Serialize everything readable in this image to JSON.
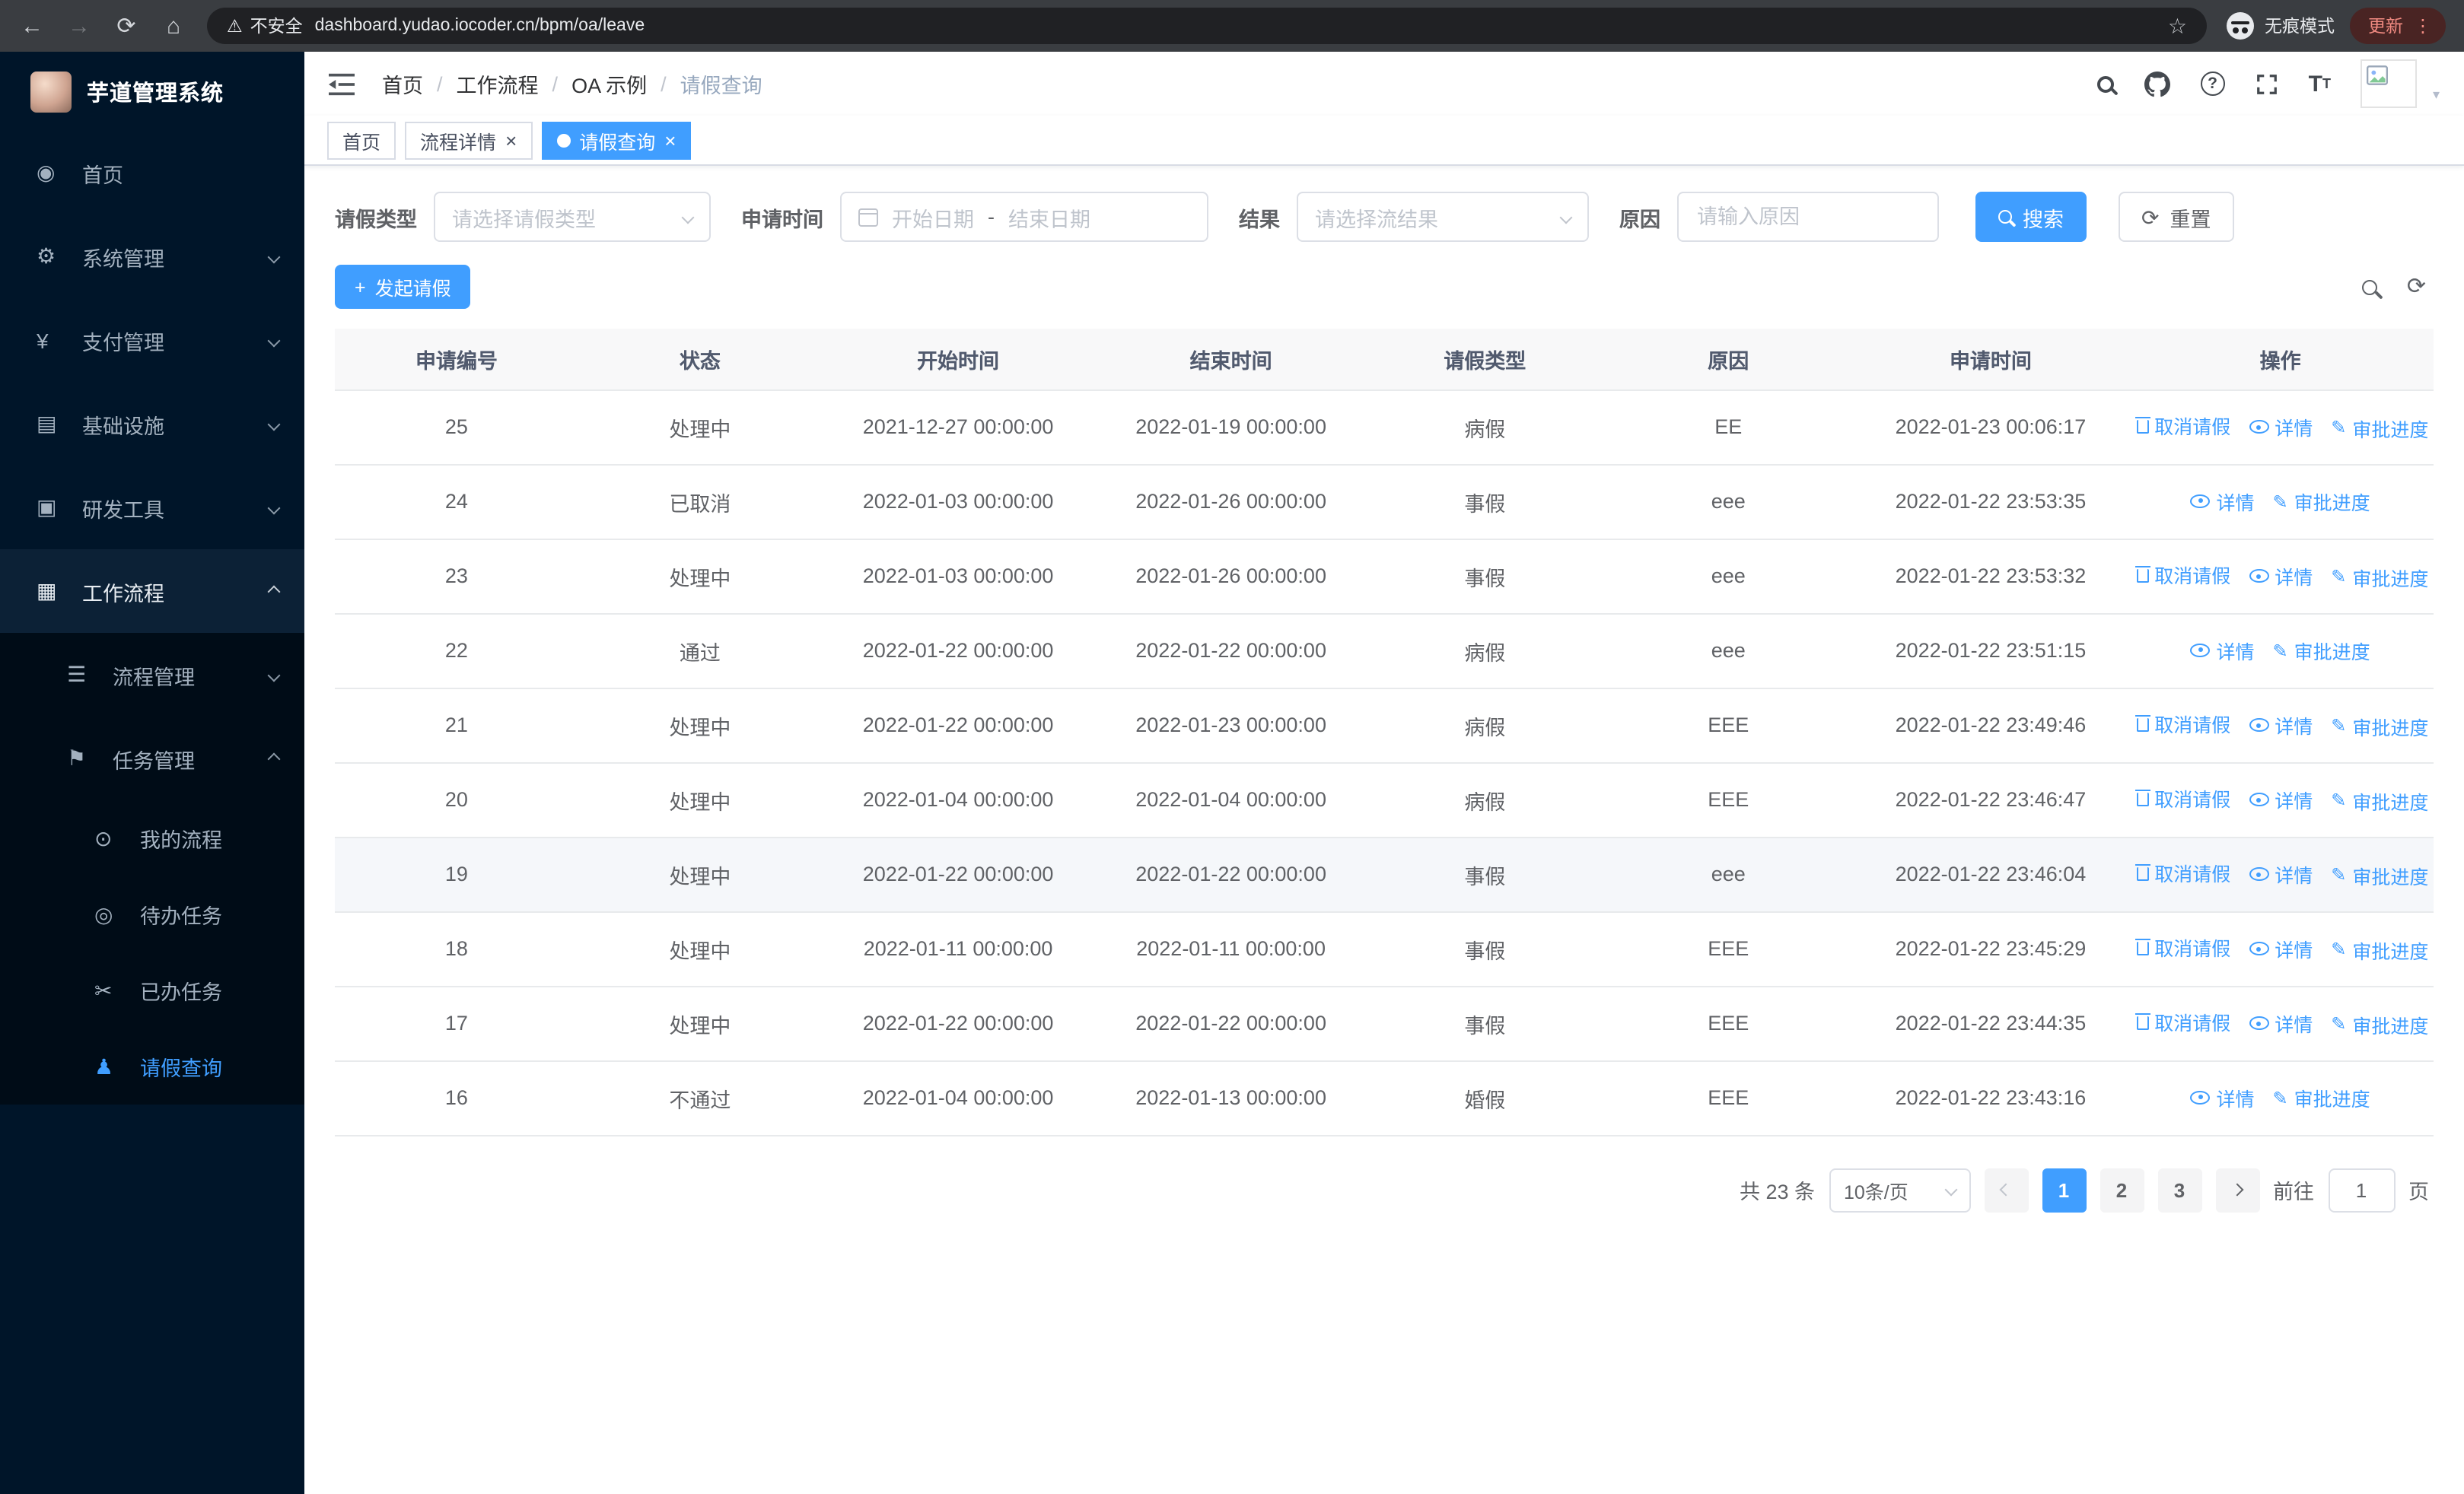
{
  "browser": {
    "security_label": "不安全",
    "url_domain": "dashboard.yudao.iocoder.cn",
    "url_path": "/bpm/oa/leave",
    "incognito_label": "无痕模式",
    "update_label": "更新"
  },
  "glyphs": {
    "back": "←",
    "forward": "→",
    "reload": "⟳",
    "home": "⌂",
    "warning": "⚠",
    "star": "☆",
    "menu_dots": "⋮",
    "close": "×",
    "caret": "▾",
    "refresh": "⟳",
    "plus": "+",
    "help": "?",
    "textsize_big": "T",
    "textsize_small": "T",
    "edit": "✎",
    "breadcrumb_sep": "/",
    "date_sep": "-"
  },
  "app": {
    "title": "芋道管理系统"
  },
  "sidebar": {
    "menu": [
      {
        "id": "home",
        "label": "首页",
        "icon": "dashboard-icon",
        "glyph": "◉",
        "level": 1,
        "chevron": ""
      },
      {
        "id": "system",
        "label": "系统管理",
        "icon": "gear-icon",
        "glyph": "⚙",
        "level": 1,
        "chevron": "down"
      },
      {
        "id": "payment",
        "label": "支付管理",
        "icon": "yen-icon",
        "glyph": "¥",
        "level": 1,
        "chevron": "down"
      },
      {
        "id": "infrastructure",
        "label": "基础设施",
        "icon": "monitor-icon",
        "glyph": "▤",
        "level": 1,
        "chevron": "down"
      },
      {
        "id": "devtools",
        "label": "研发工具",
        "icon": "toolbox-icon",
        "glyph": "▣",
        "level": 1,
        "chevron": "down"
      },
      {
        "id": "workflow",
        "label": "工作流程",
        "icon": "briefcase-icon",
        "glyph": "▦",
        "level": 1,
        "chevron": "up",
        "highlight": true
      },
      {
        "id": "process-mgmt",
        "label": "流程管理",
        "icon": "list-icon",
        "glyph": "☰",
        "level": 2,
        "chevron": "down",
        "dark": true
      },
      {
        "id": "task-mgmt",
        "label": "任务管理",
        "icon": "flag-icon",
        "glyph": "⚑",
        "level": 2,
        "chevron": "up",
        "dark": true
      },
      {
        "id": "my-process",
        "label": "我的流程",
        "icon": "chat-icon",
        "glyph": "⊙",
        "level": 3,
        "dark": true
      },
      {
        "id": "todo-tasks",
        "label": "待办任务",
        "icon": "eye-icon",
        "glyph": "◎",
        "level": 3,
        "dark": true
      },
      {
        "id": "done-tasks",
        "label": "已办任务",
        "icon": "scissors-icon",
        "glyph": "✂",
        "level": 3,
        "dark": true
      },
      {
        "id": "leave-query",
        "label": "请假查询",
        "icon": "person-icon",
        "glyph": "♟",
        "level": 3,
        "dark": true,
        "active": true
      }
    ]
  },
  "breadcrumb": {
    "items": [
      "首页",
      "工作流程",
      "OA 示例",
      "请假查询"
    ]
  },
  "tabs": [
    {
      "label": "首页",
      "closable": false,
      "active": false
    },
    {
      "label": "流程详情",
      "closable": true,
      "active": false
    },
    {
      "label": "请假查询",
      "closable": true,
      "active": true
    }
  ],
  "filters": {
    "leave_type_label": "请假类型",
    "leave_type_placeholder": "请选择请假类型",
    "apply_time_label": "申请时间",
    "start_placeholder": "开始日期",
    "end_placeholder": "结束日期",
    "result_label": "结果",
    "result_placeholder": "请选择流结果",
    "reason_label": "原因",
    "reason_placeholder": "请输入原因",
    "search_label": "搜索",
    "reset_label": "重置"
  },
  "toolbar": {
    "create_label": "发起请假"
  },
  "table": {
    "columns": [
      "申请编号",
      "状态",
      "开始时间",
      "结束时间",
      "请假类型",
      "原因",
      "申请时间",
      "操作"
    ],
    "rows": [
      {
        "id": "25",
        "status": "处理中",
        "start": "2021-12-27 00:00:00",
        "end": "2022-01-19 00:00:00",
        "type": "病假",
        "reason": "EE",
        "applied": "2022-01-23 00:06:17",
        "actions": [
          "cancel",
          "detail",
          "progress"
        ],
        "hover": false
      },
      {
        "id": "24",
        "status": "已取消",
        "start": "2022-01-03 00:00:00",
        "end": "2022-01-26 00:00:00",
        "type": "事假",
        "reason": "eee",
        "applied": "2022-01-22 23:53:35",
        "actions": [
          "detail",
          "progress"
        ],
        "hover": false
      },
      {
        "id": "23",
        "status": "处理中",
        "start": "2022-01-03 00:00:00",
        "end": "2022-01-26 00:00:00",
        "type": "事假",
        "reason": "eee",
        "applied": "2022-01-22 23:53:32",
        "actions": [
          "cancel",
          "detail",
          "progress"
        ],
        "hover": false
      },
      {
        "id": "22",
        "status": "通过",
        "start": "2022-01-22 00:00:00",
        "end": "2022-01-22 00:00:00",
        "type": "病假",
        "reason": "eee",
        "applied": "2022-01-22 23:51:15",
        "actions": [
          "detail",
          "progress"
        ],
        "hover": false
      },
      {
        "id": "21",
        "status": "处理中",
        "start": "2022-01-22 00:00:00",
        "end": "2022-01-23 00:00:00",
        "type": "病假",
        "reason": "EEE",
        "applied": "2022-01-22 23:49:46",
        "actions": [
          "cancel",
          "detail",
          "progress"
        ],
        "hover": false
      },
      {
        "id": "20",
        "status": "处理中",
        "start": "2022-01-04 00:00:00",
        "end": "2022-01-04 00:00:00",
        "type": "病假",
        "reason": "EEE",
        "applied": "2022-01-22 23:46:47",
        "actions": [
          "cancel",
          "detail",
          "progress"
        ],
        "hover": false
      },
      {
        "id": "19",
        "status": "处理中",
        "start": "2022-01-22 00:00:00",
        "end": "2022-01-22 00:00:00",
        "type": "事假",
        "reason": "eee",
        "applied": "2022-01-22 23:46:04",
        "actions": [
          "cancel",
          "detail",
          "progress"
        ],
        "hover": true
      },
      {
        "id": "18",
        "status": "处理中",
        "start": "2022-01-11 00:00:00",
        "end": "2022-01-11 00:00:00",
        "type": "事假",
        "reason": "EEE",
        "applied": "2022-01-22 23:45:29",
        "actions": [
          "cancel",
          "detail",
          "progress"
        ],
        "hover": false
      },
      {
        "id": "17",
        "status": "处理中",
        "start": "2022-01-22 00:00:00",
        "end": "2022-01-22 00:00:00",
        "type": "事假",
        "reason": "EEE",
        "applied": "2022-01-22 23:44:35",
        "actions": [
          "cancel",
          "detail",
          "progress"
        ],
        "hover": false
      },
      {
        "id": "16",
        "status": "不通过",
        "start": "2022-01-04 00:00:00",
        "end": "2022-01-13 00:00:00",
        "type": "婚假",
        "reason": "EEE",
        "applied": "2022-01-22 23:43:16",
        "actions": [
          "detail",
          "progress"
        ],
        "hover": false
      }
    ]
  },
  "actions": {
    "cancel": "取消请假",
    "detail": "详情",
    "progress": "审批进度"
  },
  "pagination": {
    "total_text": "共 23 条",
    "page_size": "10条/页",
    "pages": [
      "1",
      "2",
      "3"
    ],
    "active_page": "1",
    "goto_label": "前往",
    "goto_value": "1",
    "unit_label": "页"
  },
  "colors": {
    "primary": "#409eff",
    "sidebar_bg": "#001529",
    "submenu_bg": "#000c17"
  }
}
